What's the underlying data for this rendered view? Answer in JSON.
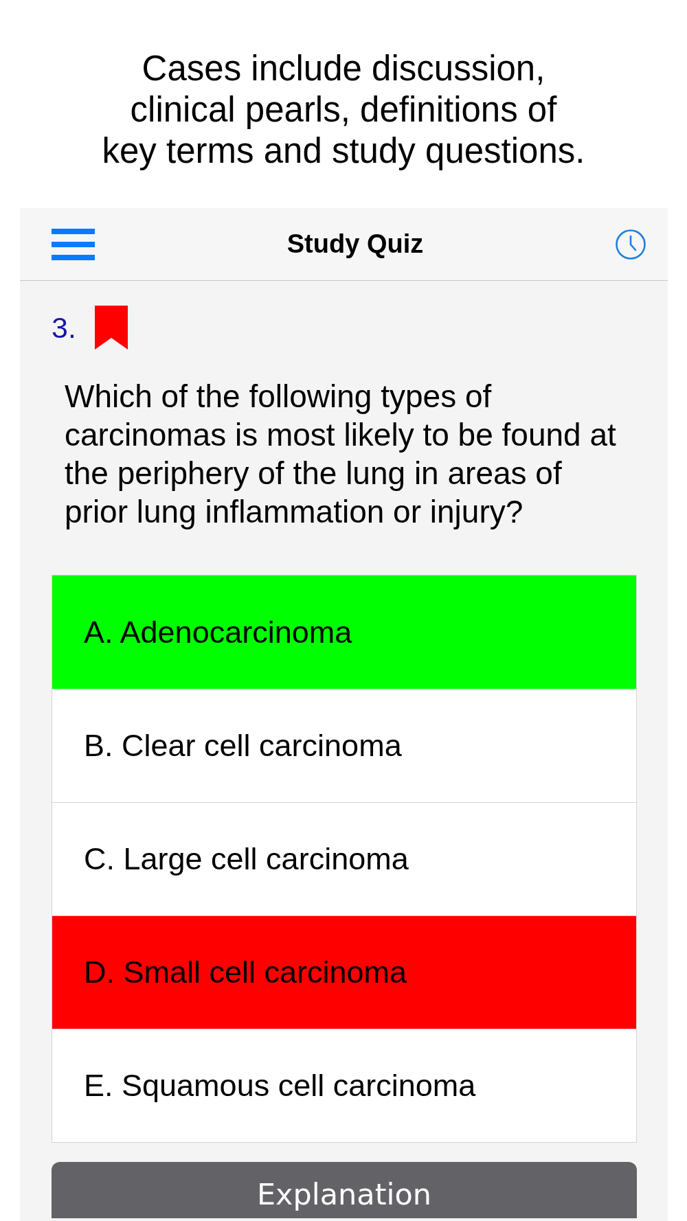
{
  "caption": "Cases include discussion,\nclinical pearls, definitions of\nkey terms and study questions.",
  "nav_bar": {
    "title": "Study Quiz"
  },
  "question": {
    "number": "3.",
    "bookmarked": true,
    "text": "Which of the following types of carcinomas is most likely to be found at the periphery of the lung in areas of prior lung inflammation or injury?"
  },
  "options": [
    {
      "label": "A. Adenocarcinoma",
      "color": "#00ff00"
    },
    {
      "label": "B. Clear cell carcinoma",
      "color": "#ffffff"
    },
    {
      "label": "C. Large cell carcinoma",
      "color": "#ffffff"
    },
    {
      "label": "D. Small cell carcinoma",
      "color": "#ff0000"
    },
    {
      "label": "E. Squamous cell carcinoma",
      "color": "#ffffff"
    }
  ],
  "explanation_button": {
    "label": "Explanation"
  }
}
